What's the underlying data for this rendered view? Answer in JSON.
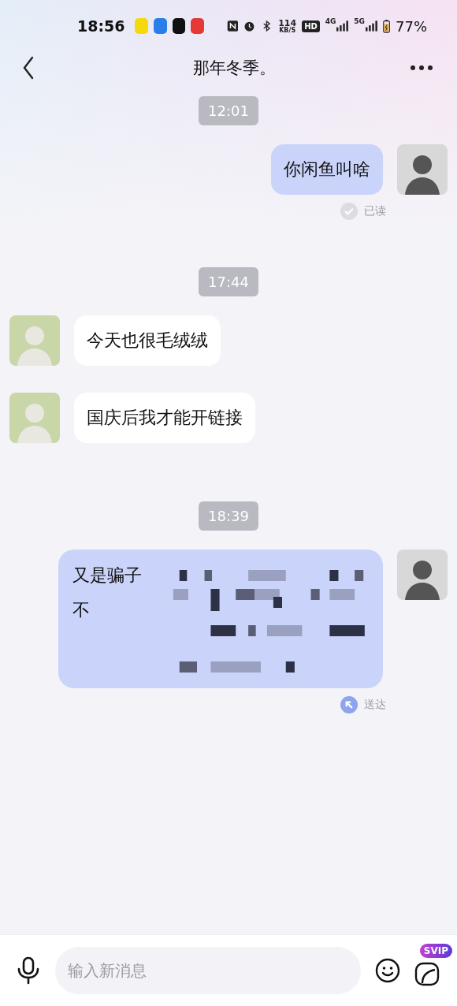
{
  "status_bar": {
    "time": "18:56",
    "speed": "114",
    "speed_unit": "KB/S",
    "hd": "HD",
    "net1": "4G",
    "net2": "5G",
    "battery": "77%"
  },
  "header": {
    "title": "那年冬季。"
  },
  "messages": [
    {
      "kind": "time",
      "text": "12:01"
    },
    {
      "kind": "message",
      "outgoing": true,
      "lines": [
        "你闲鱼叫啥"
      ],
      "redacted": false,
      "status": "已读",
      "read": true
    },
    {
      "kind": "time",
      "text": "17:44"
    },
    {
      "kind": "message",
      "outgoing": false,
      "lines": [
        "今天也很毛绒绒"
      ],
      "redacted": false
    },
    {
      "kind": "message",
      "outgoing": false,
      "lines": [
        "国庆后我才能开链接"
      ],
      "redacted": false
    },
    {
      "kind": "time",
      "text": "18:39"
    },
    {
      "kind": "message",
      "outgoing": true,
      "lines": [
        "又是骗子",
        "不"
      ],
      "redacted": true,
      "status": "送达",
      "read": false
    }
  ],
  "composer": {
    "placeholder": "输入新消息",
    "badge": "SVIP"
  }
}
